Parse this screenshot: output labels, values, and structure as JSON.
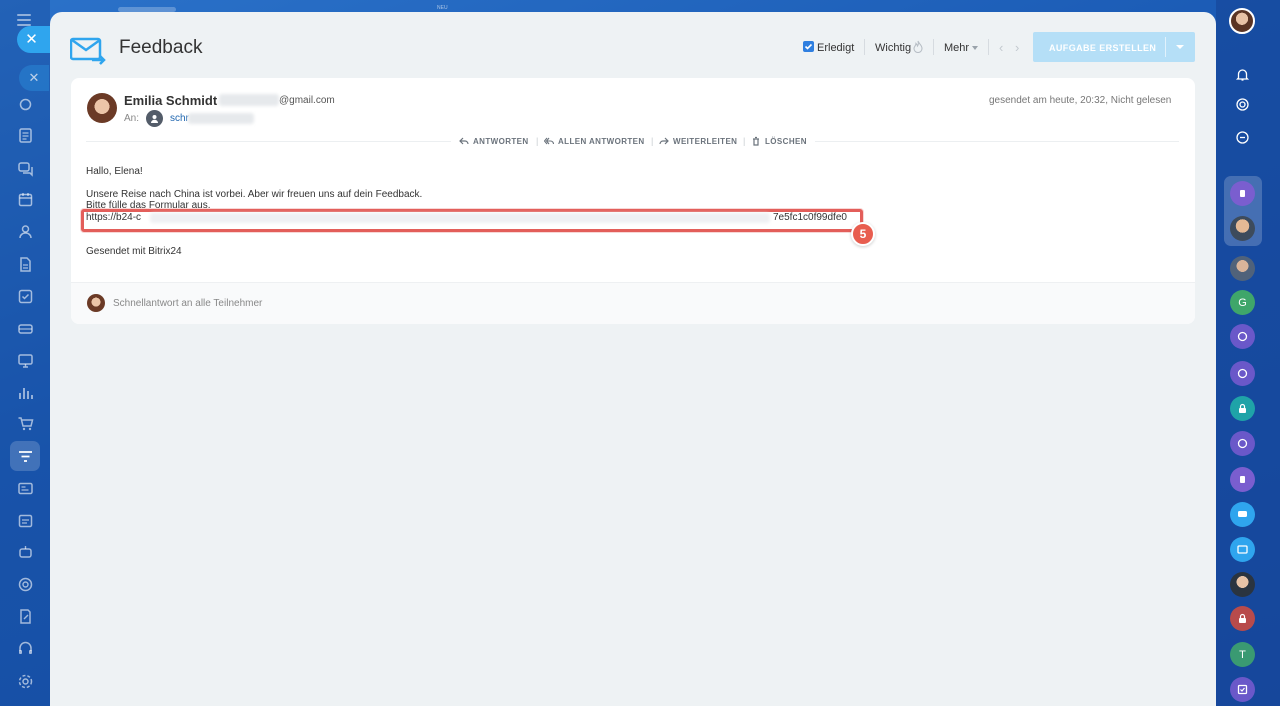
{
  "title": "Feedback",
  "top_hint": "NEU",
  "toolbar": {
    "done_label": "Erledigt",
    "important_label": "Wichtig",
    "more_label": "Mehr",
    "create_task_label": "AUFGABE ERSTELLEN"
  },
  "message": {
    "sender_name": "Emilia Schmidt",
    "sender_email_suffix": "@gmail.com",
    "sent_info": "gesendet am heute, 20:32, Nicht gelesen",
    "to_label": "An:",
    "to_name": "schr",
    "actions": {
      "reply": "ANTWORTEN",
      "reply_all": "ALLEN ANTWORTEN",
      "forward": "WEITERLEITEN",
      "delete": "LÖSCHEN"
    },
    "body": {
      "greeting": "Hallo, Elena!",
      "line1": "Unsere Reise nach China ist vorbei. Aber wir freuen uns auf dein Feedback.",
      "line2": "Bitte fülle das Formular aus.",
      "url_start": "https://b24-c",
      "url_end": "7e5fc1c0f99dfe0",
      "signature": "Gesendet mit Bitrix24"
    },
    "quick_reply": "Schnellantwort an alle Teilnehmer"
  },
  "annotation_number": "5",
  "right_rail_letters": {
    "g": "G",
    "t": "T"
  },
  "colors": {
    "accent": "#2f7fe0",
    "highlight": "#e35e5a",
    "badge": "#e85d4f",
    "create_button": "#b5dff7",
    "background": "#1b5bb5"
  }
}
